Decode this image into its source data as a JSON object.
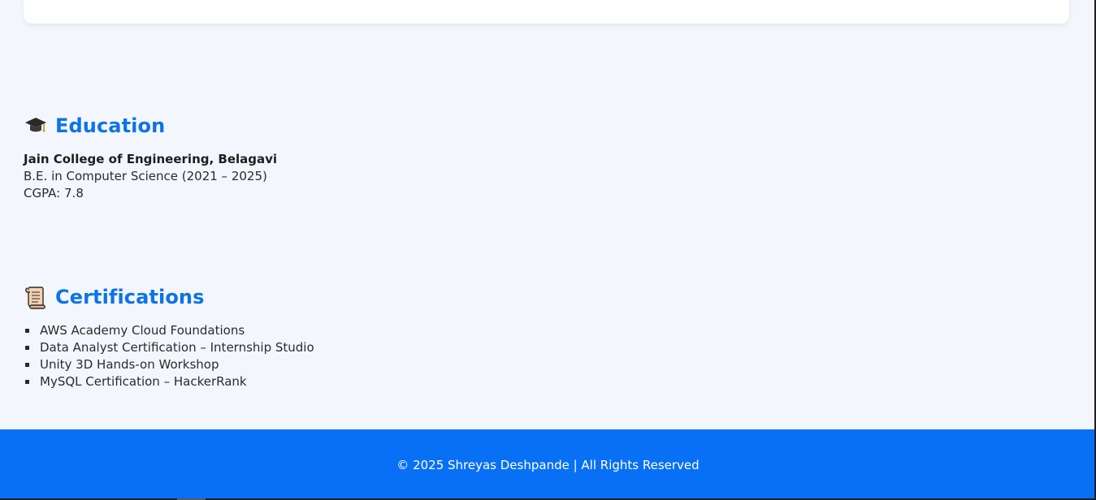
{
  "education": {
    "icon": "graduation-cap-icon",
    "title": "Education",
    "school": "Jain College of Engineering, Belagavi",
    "degree": "B.E. in Computer Science (2021 – 2025)",
    "cgpa": "CGPA: 7.8"
  },
  "certifications": {
    "icon": "scroll-icon",
    "title": "Certifications",
    "items": [
      "AWS Academy Cloud Foundations",
      "Data Analyst Certification – Internship Studio",
      "Unity 3D Hands-on Workshop",
      "MySQL Certification – HackerRank"
    ]
  },
  "footer": {
    "text": "© 2025 Shreyas Deshpande | All Rights Reserved"
  },
  "colors": {
    "accent": "#0d73e8",
    "footer_bg": "#0870f5",
    "page_bg": "#f3f7fd"
  }
}
